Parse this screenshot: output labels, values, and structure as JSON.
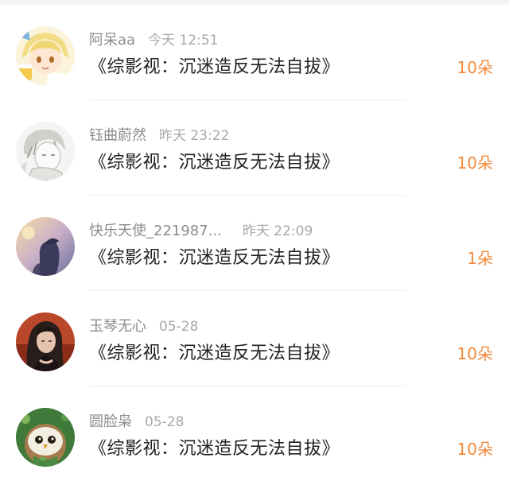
{
  "accent_color": "#f28a3c",
  "items": [
    {
      "name": "阿呆aa",
      "time": "今天 12:51",
      "title": "《综影视：沉迷造反无法自拔》",
      "count": "10朵",
      "avatar_icon": "anime-blonde-girl-avatar"
    },
    {
      "name": "钰曲蔚然",
      "time": "昨天 23:22",
      "title": "《综影视：沉迷造反无法自拔》",
      "count": "10朵",
      "avatar_icon": "sketch-boy-avatar"
    },
    {
      "name": "快乐天使_221987...",
      "time": "昨天 22:09",
      "title": "《综影视：沉迷造反无法自拔》",
      "count": "1朵",
      "avatar_icon": "sunset-silhouette-avatar"
    },
    {
      "name": "玉琴无心",
      "time": "05-28",
      "title": "《综影视：沉迷造反无法自拔》",
      "count": "10朵",
      "avatar_icon": "dark-hair-portrait-avatar"
    },
    {
      "name": "圆脸枭",
      "time": "05-28",
      "title": "《综影视：沉迷造反无法自拔》",
      "count": "10朵",
      "avatar_icon": "owl-character-avatar"
    }
  ]
}
